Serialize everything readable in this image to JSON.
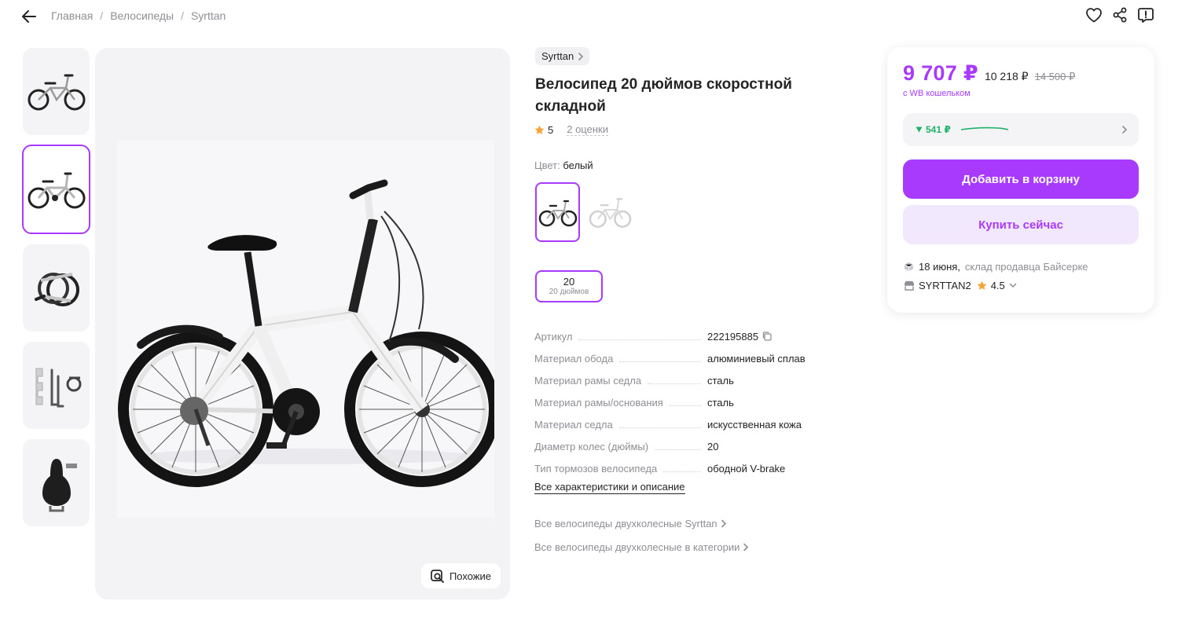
{
  "breadcrumb": {
    "items": [
      "Главная",
      "Велосипеды",
      "Syrttan"
    ],
    "separator": "/"
  },
  "gallery": {
    "thumbnails": [
      "bike-side-view",
      "bike-side-view-2",
      "bike-folded",
      "tools-kit",
      "saddle"
    ],
    "active_index": 1,
    "similar_label": "Похожие"
  },
  "product": {
    "brand": "Syrttan",
    "title": "Велосипед 20 дюймов скоростной складной",
    "rating": "5",
    "reviews": "2 оценки",
    "color_label": "Цвет:",
    "color_value": "белый",
    "size_value": "20",
    "size_sub": "20 дюймов",
    "specs": [
      {
        "key": "Артикул",
        "value": "222195885"
      },
      {
        "key": "Материал обода",
        "value": "алюминиевый сплав"
      },
      {
        "key": "Материал рамы седла",
        "value": "сталь"
      },
      {
        "key": "Материал рамы/основания",
        "value": "сталь"
      },
      {
        "key": "Материал седла",
        "value": "искусственная кожа"
      },
      {
        "key": "Диаметр колес (дюймы)",
        "value": "20"
      },
      {
        "key": "Тип тормозов велосипеда",
        "value": "ободной V-brake"
      }
    ],
    "all_specs_link": "Все характеристики и описание",
    "brand_link": "Все велосипеды двухколесные Syrttan",
    "category_link": "Все велосипеды двухколесные в категории"
  },
  "price_card": {
    "price": "9 707 ₽",
    "price_without_wallet": "10 218 ₽",
    "price_old": "14 500 ₽",
    "wallet_note": "с WB кошельком",
    "cashback": "541 ₽",
    "add_to_cart": "Добавить в корзину",
    "buy_now": "Купить сейчас",
    "delivery_date": "18 июня,",
    "delivery_place": "склад продавца Байсерке",
    "seller_name": "SYRTTAN2",
    "seller_rating": "4.5"
  },
  "colors": {
    "accent": "#a73afd",
    "accent_light": "#f2e8fe",
    "cashback_green": "#1fb26a",
    "star": "#f7a43a",
    "muted": "#8e8e95"
  }
}
